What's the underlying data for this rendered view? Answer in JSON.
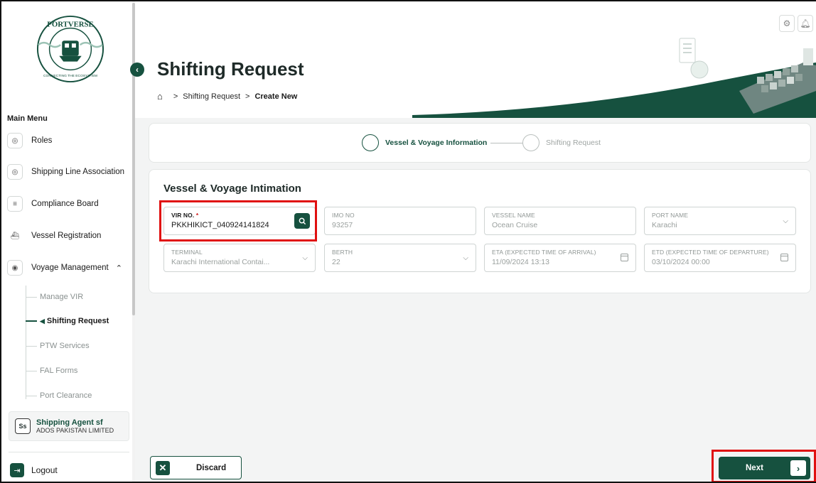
{
  "brand": {
    "logo_text": "PORTVERSE",
    "logo_tagline": "CONNECTING THE ECOSYSTEM"
  },
  "colors": {
    "primary": "#16513f",
    "highlight": "#e01010",
    "required": "#d01919"
  },
  "sidebar": {
    "menu_title": "Main Menu",
    "items": [
      {
        "label": "Roles",
        "icon": "roles-icon"
      },
      {
        "label": "Shipping Line Association",
        "icon": "association-icon"
      },
      {
        "label": "Compliance Board",
        "icon": "document-icon"
      },
      {
        "label": "Vessel Registration",
        "icon": "ship-icon"
      },
      {
        "label": "Voyage Management",
        "icon": "location-icon",
        "expanded": true
      }
    ],
    "sub_items": [
      {
        "label": "Manage VIR"
      },
      {
        "label": "Shifting Request",
        "active": true
      },
      {
        "label": "PTW Services"
      },
      {
        "label": "FAL Forms"
      },
      {
        "label": "Port Clearance"
      }
    ],
    "user": {
      "initials": "Ss",
      "name": "Shipping Agent sf",
      "company": "ADOS PAKISTAN LIMITED"
    },
    "logout_label": "Logout"
  },
  "header": {
    "title": "Shifting Request",
    "breadcrumb": [
      "Shifting Request",
      "Create New"
    ]
  },
  "stepper": {
    "steps": [
      {
        "label": "Vessel & Voyage Information",
        "active": true
      },
      {
        "label": "Shifting Request",
        "active": false
      }
    ]
  },
  "form": {
    "title": "Vessel & Voyage Intimation",
    "vir_no": {
      "label": "VIR NO.",
      "required_mark": "*",
      "value": "PKKHIKICT_040924141824"
    },
    "imo_no": {
      "label": "IMO NO",
      "value": "93257"
    },
    "vessel_name": {
      "label": "VESSEL NAME",
      "value": "Ocean Cruise"
    },
    "port_name": {
      "label": "PORT NAME",
      "value": "Karachi"
    },
    "terminal": {
      "label": "TERMINAL",
      "value": "Karachi International Contai..."
    },
    "berth": {
      "label": "BERTH",
      "value": "22"
    },
    "eta": {
      "label": "ETA (EXPECTED TIME OF ARRIVAL)",
      "value": "11/09/2024 13:13"
    },
    "etd": {
      "label": "ETD (EXPECTED TIME OF DEPARTURE)",
      "value": "03/10/2024 00:00"
    }
  },
  "footer": {
    "discard_label": "Discard",
    "next_label": "Next"
  }
}
